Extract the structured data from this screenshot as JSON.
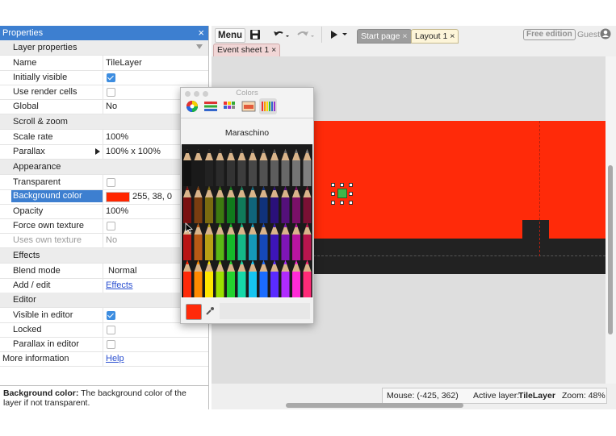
{
  "properties": {
    "title": "Properties",
    "close_glyph": "×",
    "layer_header": "Layer properties",
    "rows": {
      "name": {
        "label": "Name",
        "value": "TileLayer"
      },
      "initially_visible": {
        "label": "Initially visible",
        "checked": true
      },
      "use_render_cells": {
        "label": "Use render cells",
        "checked": false
      },
      "global": {
        "label": "Global",
        "value": "No"
      },
      "scroll_zoom": {
        "label": "Scroll & zoom"
      },
      "scale_rate": {
        "label": "Scale rate",
        "value": "100%"
      },
      "parallax": {
        "label": "Parallax",
        "value": "100% x 100%"
      },
      "appearance": {
        "label": "Appearance"
      },
      "transparent": {
        "label": "Transparent",
        "checked": false
      },
      "background_color": {
        "label": "Background color",
        "value": "255, 38, 0",
        "color": "#ff2600"
      },
      "opacity": {
        "label": "Opacity",
        "value": "100%"
      },
      "force_own_texture": {
        "label": "Force own texture",
        "checked": false
      },
      "uses_own_texture": {
        "label": "Uses own texture",
        "value": "No"
      },
      "effects": {
        "label": "Effects"
      },
      "blend_mode": {
        "label": "Blend mode",
        "value": "Normal"
      },
      "add_edit": {
        "label": "Add / edit",
        "value": "Effects"
      },
      "editor": {
        "label": "Editor"
      },
      "visible_in_editor": {
        "label": "Visible in editor",
        "checked": true
      },
      "locked": {
        "label": "Locked",
        "checked": false
      },
      "parallax_in_editor": {
        "label": "Parallax in editor",
        "checked": false
      },
      "more_information": {
        "label": "More information",
        "value": "Help"
      }
    },
    "description": {
      "bold": "Background color:",
      "text": " The background color of the layer if not transparent."
    }
  },
  "toolbar": {
    "menu_label": "Menu",
    "free_edition": "Free edition",
    "user": "Guest",
    "tabs": [
      "Start page",
      "Layout 1"
    ],
    "subtabs": [
      "Event sheet 1"
    ]
  },
  "status": {
    "mouse": "Mouse: (-425, 362)",
    "active_layer_label": "Active layer:",
    "active_layer": "TileLayer",
    "zoom": "Zoom: 48%"
  },
  "colors_dialog": {
    "title": "Colors",
    "palette_name": "Maraschino",
    "current_color": "#ff2a09",
    "tools": [
      "color-wheel-icon",
      "color-sliders-icon",
      "color-palettes-icon",
      "image-palettes-icon",
      "crayons-icon"
    ]
  },
  "colors": {
    "accent": "#3d7fd0",
    "layout_red": "#ff2a09",
    "dark_tiles": "#222222"
  }
}
